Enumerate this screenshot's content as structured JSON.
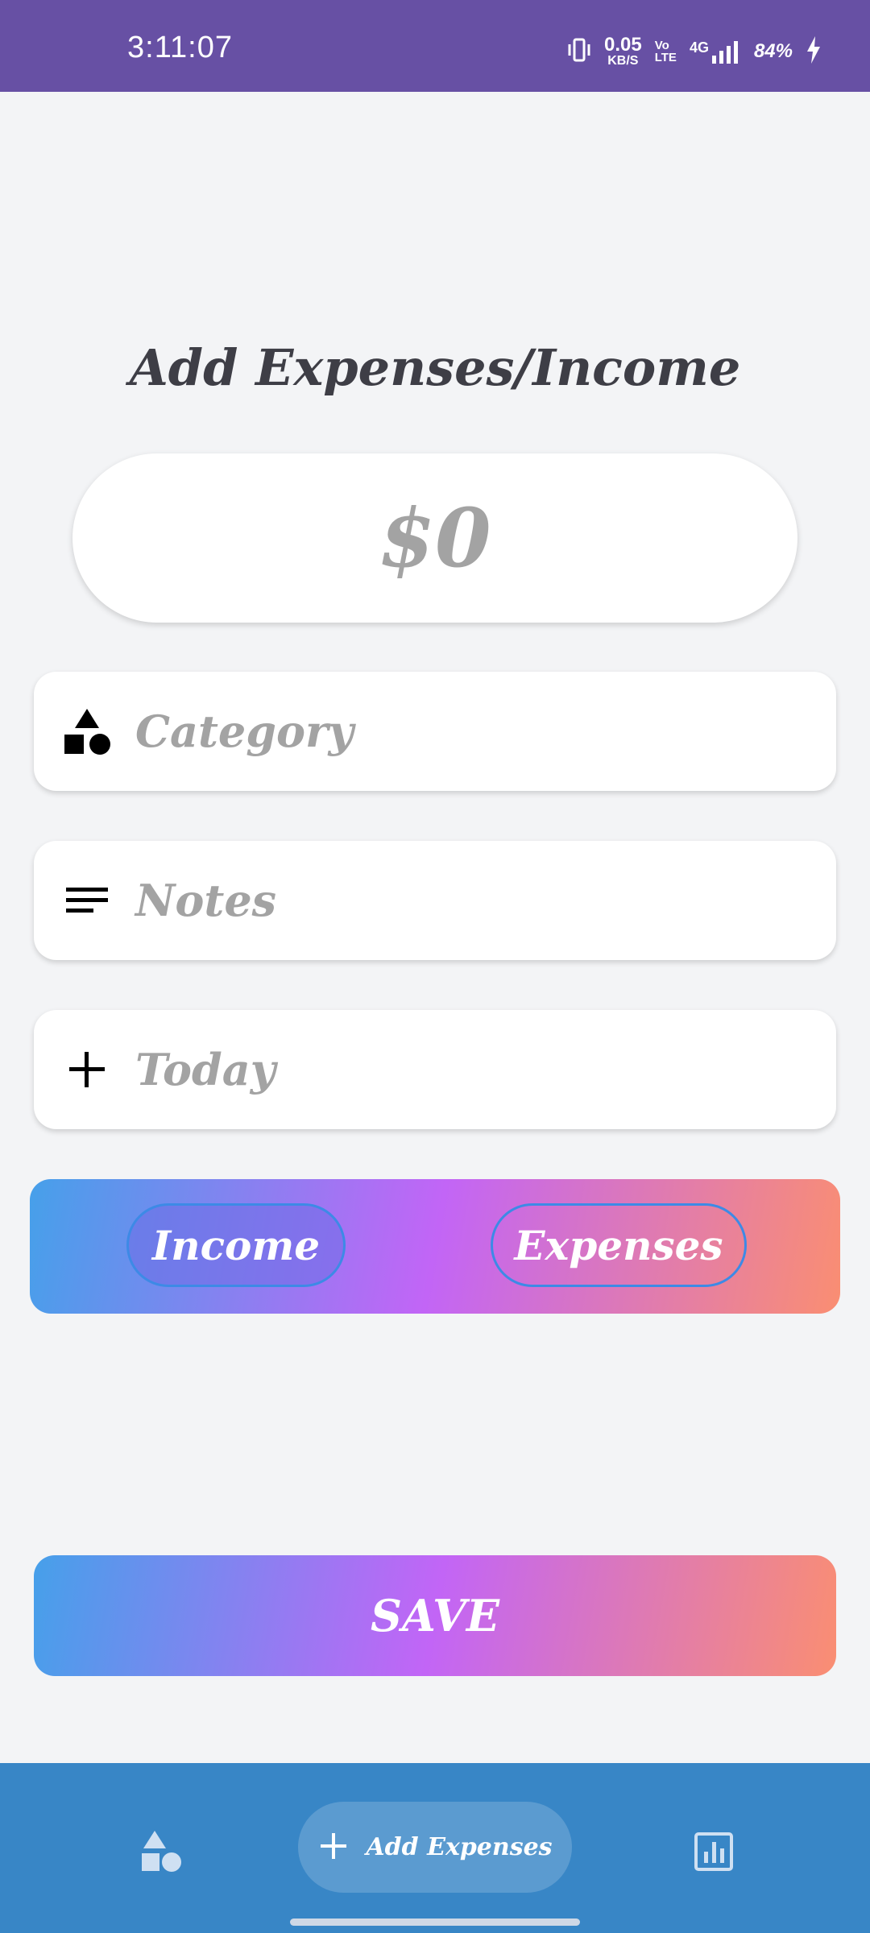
{
  "status_bar": {
    "time": "3:11:07",
    "net_speed_value": "0.05",
    "net_speed_unit": "KB/S",
    "volte_top": "Vo",
    "volte_bottom": "LTE",
    "network": "4G",
    "battery": "84%"
  },
  "page": {
    "title": "Add Expenses/Income"
  },
  "amount": {
    "placeholder": "$0"
  },
  "fields": {
    "category": {
      "label": "Category",
      "icon": "shapes-icon"
    },
    "notes": {
      "label": "Notes",
      "icon": "notes-icon"
    },
    "date": {
      "label": "Today",
      "icon": "plus-icon"
    }
  },
  "type_toggle": {
    "income_label": "Income",
    "expenses_label": "Expenses",
    "selected": "Income"
  },
  "save_button": {
    "label": "SAVE"
  },
  "bottom_nav": {
    "home_icon": "shapes-icon",
    "add_label": "Add Expenses",
    "stats_icon": "bar-chart-icon"
  },
  "colors": {
    "status_bar": "#6750a4",
    "bottom_nav": "#3886c6",
    "gradient_start": "#46a0ea",
    "gradient_mid": "#c265f6",
    "gradient_end": "#fa8e72"
  }
}
